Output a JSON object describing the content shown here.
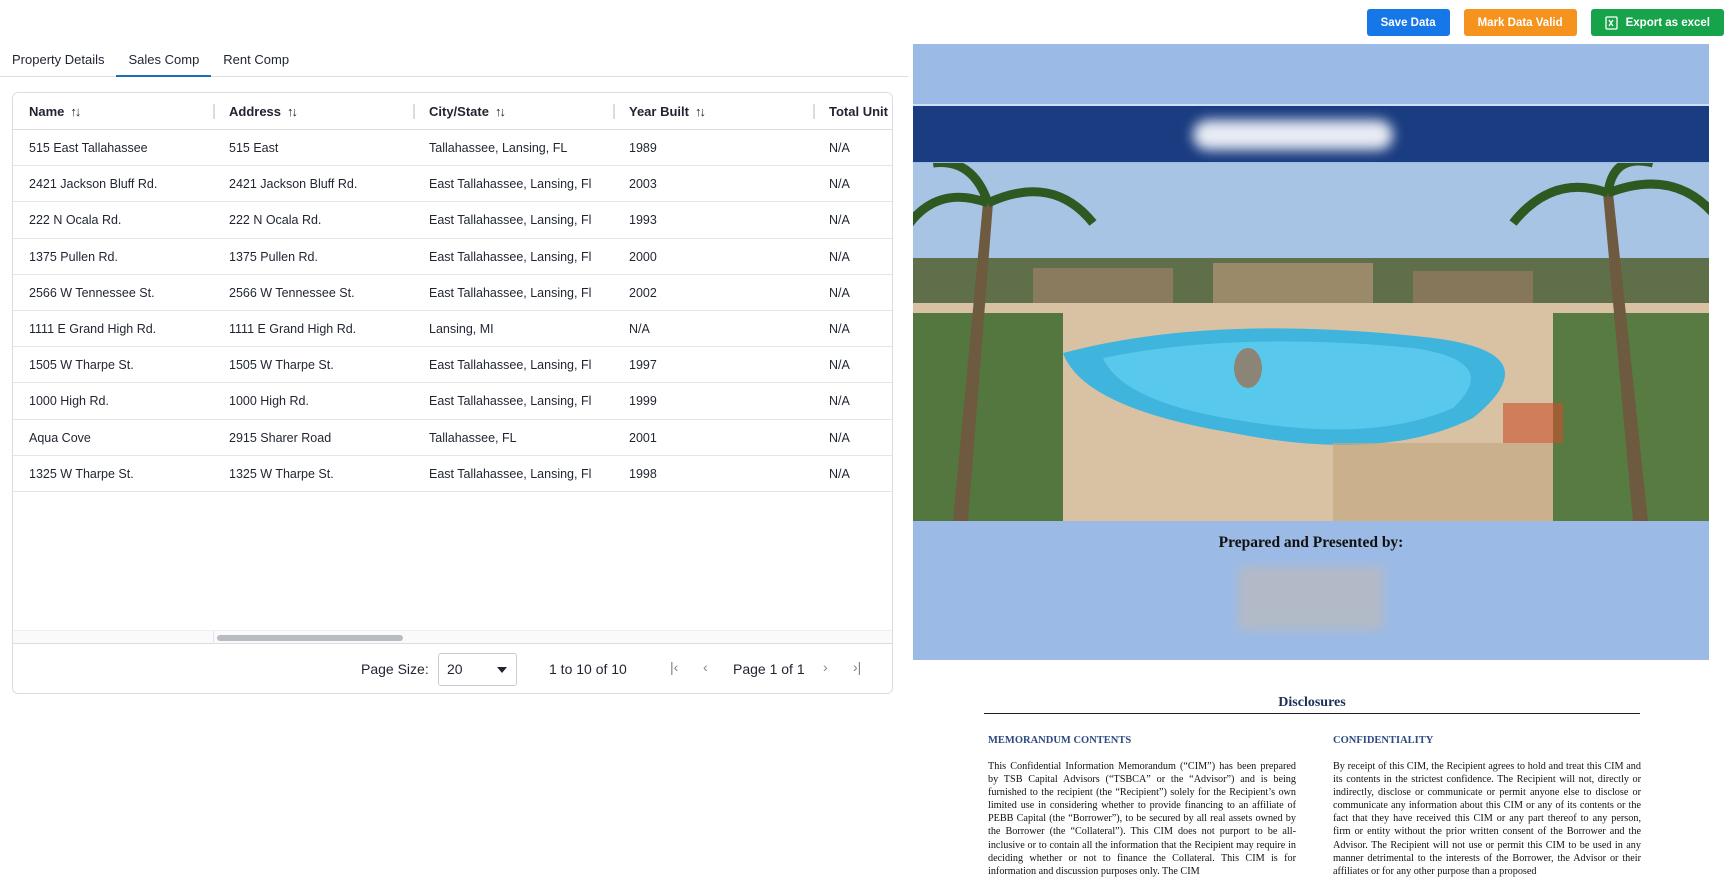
{
  "actions": {
    "save": "Save Data",
    "mark_valid": "Mark Data Valid",
    "export": "Export as excel"
  },
  "tabs": [
    {
      "label": "Property Details",
      "active": false
    },
    {
      "label": "Sales Comp",
      "active": true
    },
    {
      "label": "Rent Comp",
      "active": false
    }
  ],
  "grid": {
    "columns": [
      "Name",
      "Address",
      "City/State",
      "Year Built",
      "Total Unit"
    ],
    "rows": [
      [
        "515 East Tallahassee",
        "515 East",
        "Tallahassee, Lansing, FL",
        "1989",
        "N/A"
      ],
      [
        "2421 Jackson Bluff Rd.",
        "2421 Jackson Bluff Rd.",
        "East Tallahassee, Lansing, Fl",
        "2003",
        "N/A"
      ],
      [
        "222 N Ocala Rd.",
        "222 N Ocala Rd.",
        "East Tallahassee, Lansing, Fl",
        "1993",
        "N/A"
      ],
      [
        "1375 Pullen Rd.",
        "1375 Pullen Rd.",
        "East Tallahassee, Lansing, Fl",
        "2000",
        "N/A"
      ],
      [
        "2566 W Tennessee St.",
        "2566 W Tennessee St.",
        "East Tallahassee, Lansing, Fl",
        "2002",
        "N/A"
      ],
      [
        "1111 E Grand High Rd.",
        "1111 E Grand High Rd.",
        "Lansing, MI",
        "N/A",
        "N/A"
      ],
      [
        "1505 W Tharpe St.",
        "1505 W Tharpe St.",
        "East Tallahassee, Lansing, Fl",
        "1997",
        "N/A"
      ],
      [
        "1000 High Rd.",
        "1000 High Rd.",
        "East Tallahassee, Lansing, Fl",
        "1999",
        "N/A"
      ],
      [
        "Aqua Cove",
        "2915 Sharer Road",
        "Tallahassee, FL",
        "2001",
        "N/A"
      ],
      [
        "1325 W Tharpe St.",
        "1325 W Tharpe St.",
        "East Tallahassee, Lansing, Fl",
        "1998",
        "N/A"
      ]
    ]
  },
  "pager": {
    "page_size_label": "Page Size:",
    "page_size": "20",
    "summary": "1 to 10 of 10",
    "page_label": "Page 1 of 1"
  },
  "document": {
    "prepared_by": "Prepared and Presented by:",
    "disclosures_title": "Disclosures",
    "col1_heading": "MEMORANDUM CONTENTS",
    "col1_text": "This Confidential Information Memorandum (“CIM”) has been prepared by TSB Capital Advisors (“TSBCA” or the “Advisor”) and is being furnished to the recipient (the “Recipient”) solely for the Recipient’s own limited use in considering whether to provide financing to an affiliate of PEBB Capital (the “Borrower”), to be secured by all real assets owned by the Borrower (the “Collateral”). This CIM does not purport to be all-inclusive or to contain all the information that the Recipient may require in deciding whether or not to finance the Collateral. This CIM is for information and discussion purposes only. The CIM",
    "col2_heading": "CONFIDENTIALITY",
    "col2_text": "By receipt of this CIM, the Recipient agrees to hold and treat this CIM and its contents in the strictest confidence. The Recipient will not, directly or indirectly, disclose or communicate or permit anyone else to disclose or communicate any information about this CIM or any of its contents or the fact that they have received this CIM or any part thereof to any person, firm or entity without the prior written consent of the Borrower and the Advisor. The Recipient will not use or permit this CIM to be used in any manner detrimental to the interests of the Borrower, the Advisor or their affiliates or for any other purpose than a proposed"
  },
  "colors": {
    "save": "#1677e8",
    "mark_valid": "#f5931e",
    "export": "#17a34a",
    "cover_bg": "#9bbbe6",
    "navy_band": "#1a3c80",
    "active_tab": "#1f6fb8"
  }
}
